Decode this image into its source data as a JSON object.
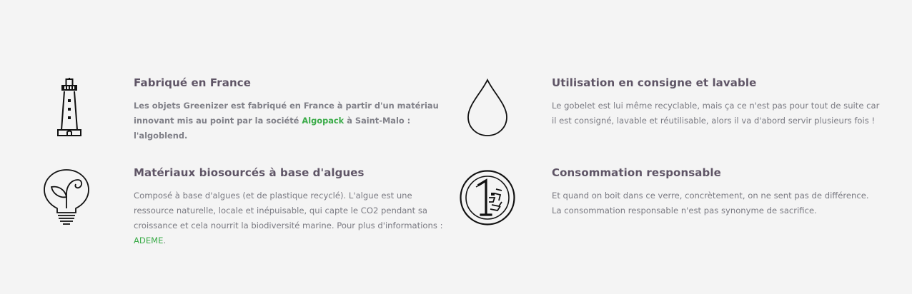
{
  "features": [
    {
      "icon": "lighthouse-icon",
      "title": "Fabriqué en France",
      "text_before": "Les objets Greenizer est fabriqué en France à partir d'un matériau innovant mis au point par la société ",
      "link": "Algopack",
      "text_after": " à Saint-Malo : l'algoblend."
    },
    {
      "icon": "water-drop-icon",
      "title": "Utilisation en consigne et lavable",
      "text": "Le gobelet est lui même recyclable, mais ça ce n'est pas pour tout de suite car il est consigné, lavable et réutilisable, alors il va d'abord servir plusieurs fois !"
    },
    {
      "icon": "eco-bulb-icon",
      "title": "Matériaux biosourcés à base d'algues",
      "text_before": "Composé à base d'algues (et de plastique recyclé). L'algue est une ressource naturelle, locale et inépuisable, qui capte le CO2 pendant sa croissance et cela nourrit la biodiversité marine. Pour plus d'informations : ",
      "link": "ADEME",
      "text_after": "."
    },
    {
      "icon": "euro-coin-icon",
      "title": "Consommation responsable",
      "text": "Et quand on boit dans ce verre, concrètement, on ne sent pas de différence. La consommation responsable n'est pas synonyme de sacrifice."
    }
  ],
  "colors": {
    "background": "#f4f4f4",
    "title": "#5f5566",
    "body_text": "#7a7a82",
    "link": "#3aab48",
    "icon_stroke": "#111111"
  }
}
